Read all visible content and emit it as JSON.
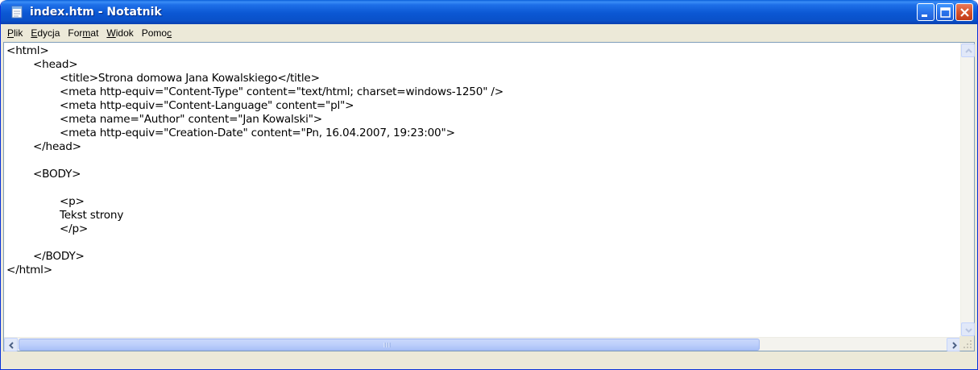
{
  "window": {
    "title": "index.htm - Notatnik",
    "icon": "notepad-icon",
    "buttons": [
      "minimize-icon",
      "maximize-icon",
      "close-icon"
    ]
  },
  "menu": {
    "items": [
      {
        "label": "Plik",
        "accel": "P",
        "rest": "lik"
      },
      {
        "label": "Edycja",
        "accel": "E",
        "rest": "dycja"
      },
      {
        "label": "Format",
        "pre": "For",
        "accel": "m",
        "rest": "at"
      },
      {
        "label": "Widok",
        "accel": "W",
        "rest": "idok"
      },
      {
        "label": "Pomoc",
        "pre": "Pomo",
        "accel": "c",
        "rest": ""
      }
    ]
  },
  "document": {
    "lines": [
      "<html>",
      "\t<head>",
      "\t\t<title>Strona domowa Jana Kowalskiego</title>",
      "\t\t<meta http-equiv=\"Content-Type\" content=\"text/html; charset=windows-1250\" />",
      "\t\t<meta http-equiv=\"Content-Language\" content=\"pl\">",
      "\t\t<meta name=\"Author\" content=\"Jan Kowalski\">",
      "\t\t<meta http-equiv=\"Creation-Date\" content=\"Pn, 16.04.2007, 19:23:00\">",
      "\t</head>",
      "",
      "\t<BODY>",
      "",
      "\t\t<p>",
      "\t\tTekst strony",
      "\t\t</p>",
      "",
      "\t</BODY>",
      "</html>"
    ]
  },
  "colors": {
    "titlebar": "#0a57d3",
    "frame": "#ece9d8",
    "close_button": "#d6532c"
  }
}
